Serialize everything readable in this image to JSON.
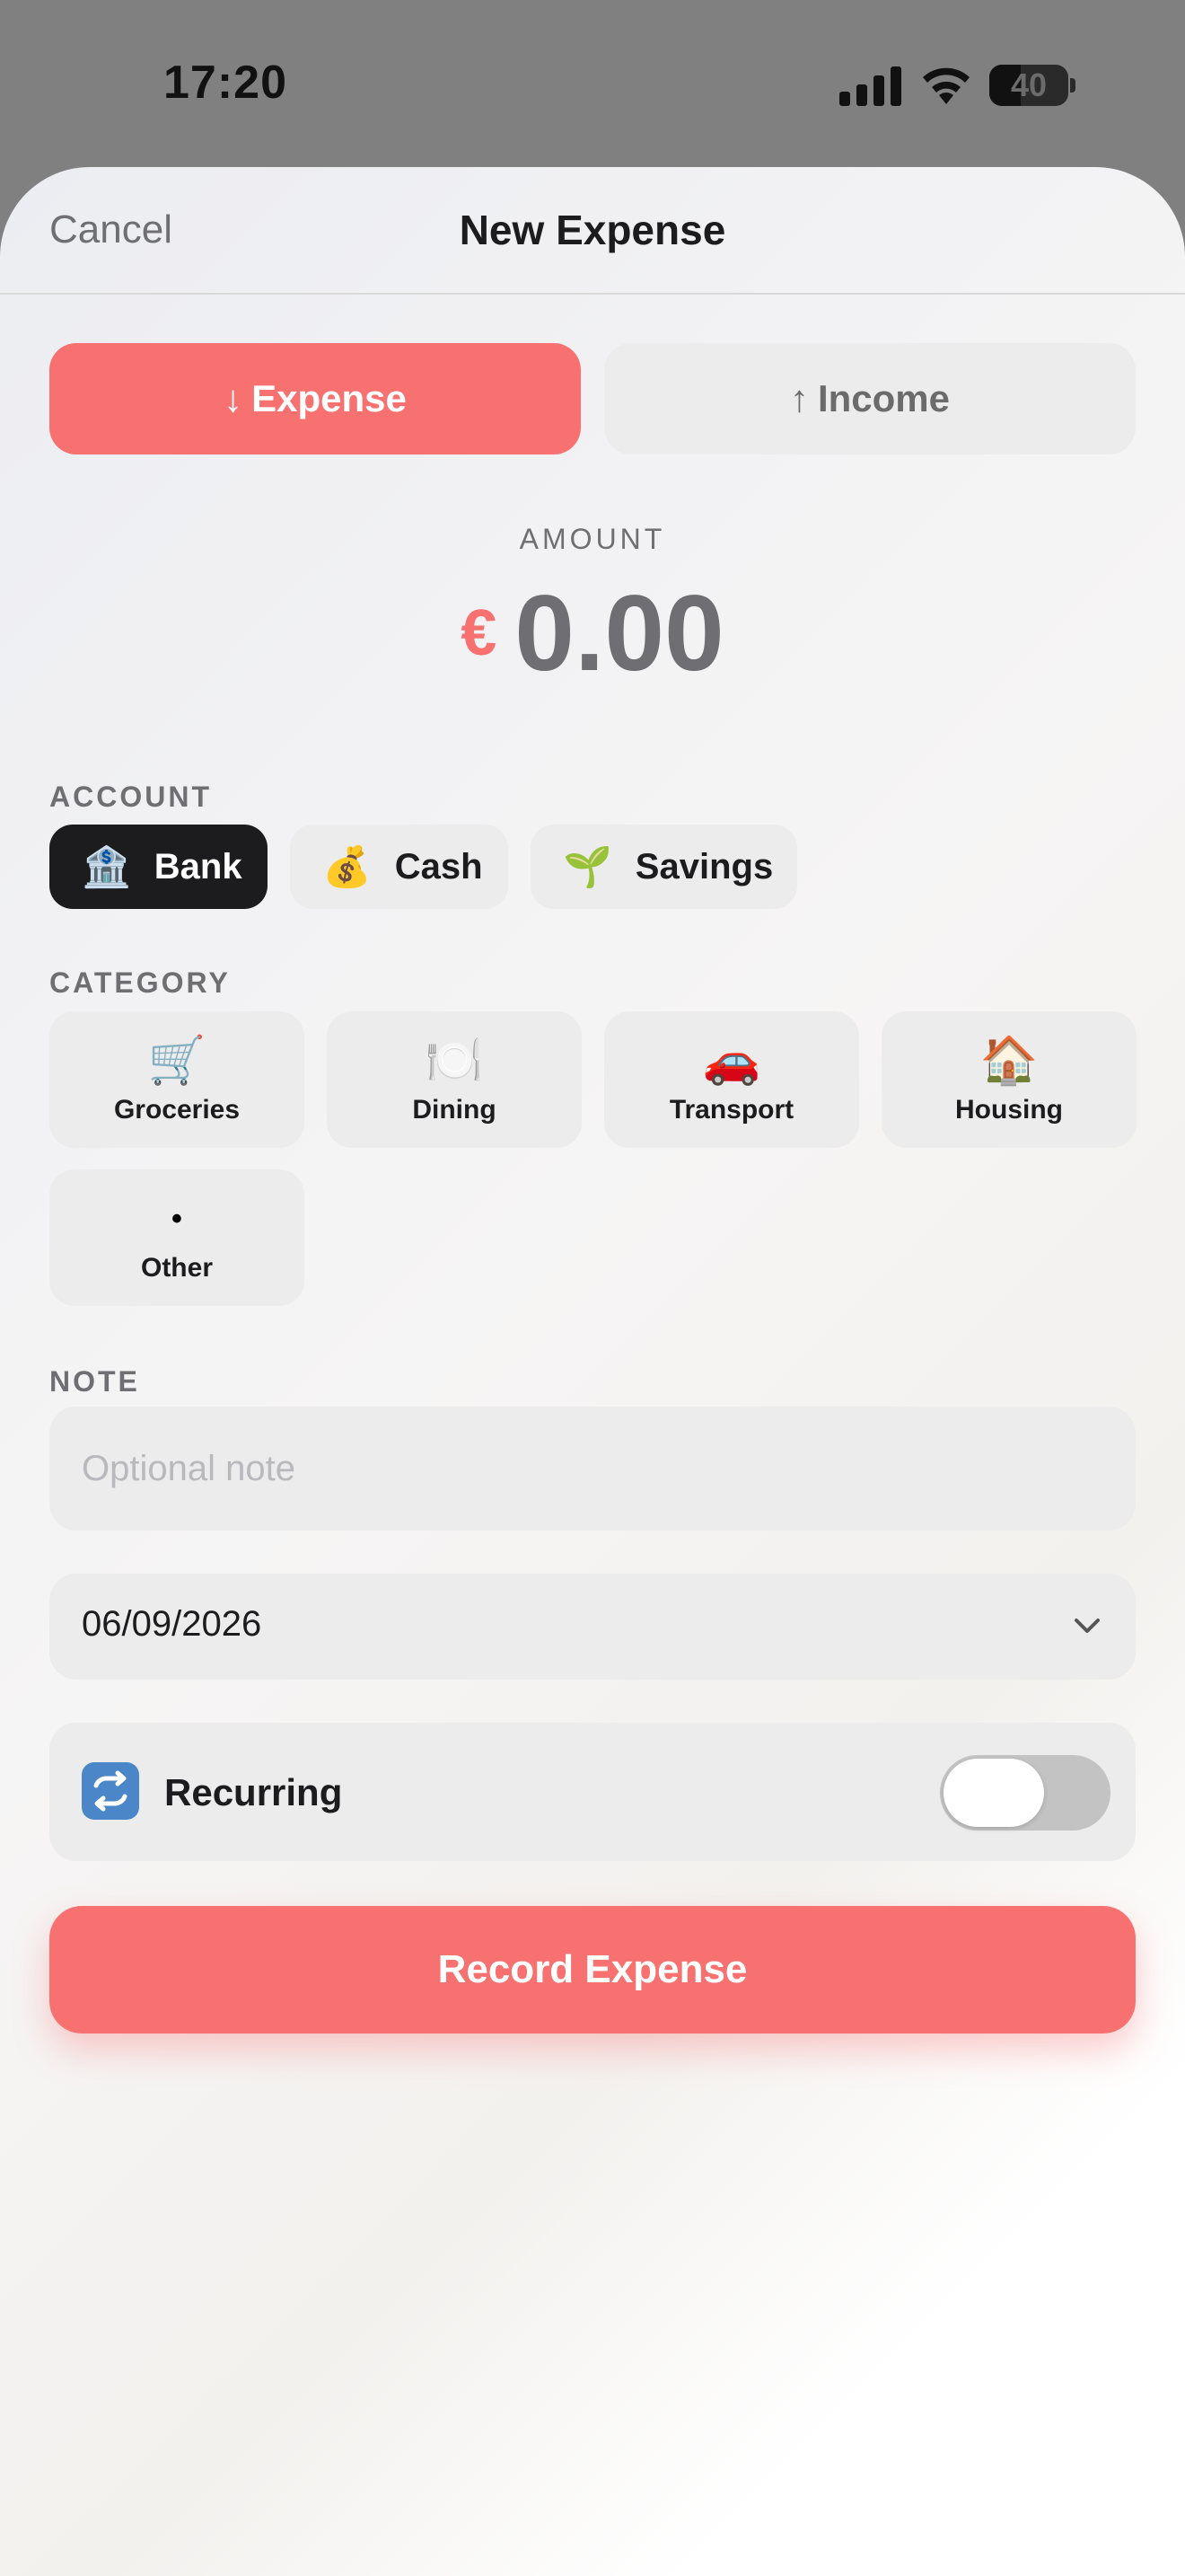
{
  "status": {
    "time": "17:20",
    "battery": "40",
    "battery_level": 0.4
  },
  "nav": {
    "cancel": "Cancel",
    "title": "New Expense"
  },
  "type_toggle": {
    "expense": {
      "arrow": "↓",
      "label": "Expense",
      "selected": true
    },
    "income": {
      "arrow": "↑",
      "label": "Income",
      "selected": false
    }
  },
  "amount": {
    "label": "AMOUNT",
    "currency": "€",
    "value": "0.00"
  },
  "account": {
    "label": "ACCOUNT",
    "items": [
      {
        "emoji": "🏦",
        "label": "Bank",
        "selected": true
      },
      {
        "emoji": "💰",
        "label": "Cash",
        "selected": false
      },
      {
        "emoji": "🌱",
        "label": "Savings",
        "selected": false
      }
    ]
  },
  "category": {
    "label": "CATEGORY",
    "items": [
      {
        "emoji": "🛒",
        "label": "Groceries"
      },
      {
        "emoji": "🍽️",
        "label": "Dining"
      },
      {
        "emoji": "🚗",
        "label": "Transport"
      },
      {
        "emoji": "🏠",
        "label": "Housing"
      },
      {
        "emoji": "•",
        "label": "Other"
      }
    ]
  },
  "note": {
    "label": "NOTE",
    "placeholder": "Optional note",
    "value": ""
  },
  "date": {
    "value": "06/09/2026"
  },
  "recurring": {
    "emoji": "🔁",
    "label": "Recurring",
    "on": false
  },
  "submit": {
    "label": "Record Expense"
  },
  "colors": {
    "accent": "#f87171",
    "dark": "#1c1c1e",
    "chip": "#ececec"
  }
}
